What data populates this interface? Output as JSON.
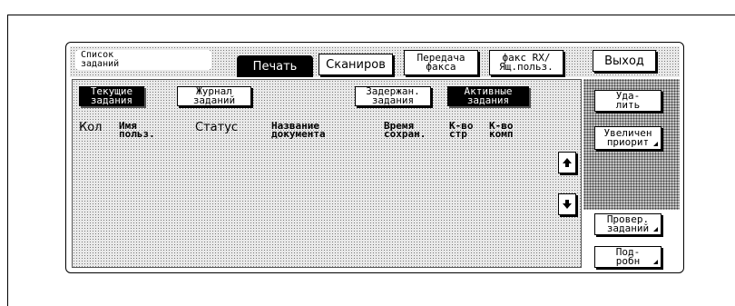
{
  "header": {
    "jobs_list_label": "Список\nзаданий",
    "tabs": [
      "Печать",
      "Сканиров",
      "Передача\nфакса",
      "факс RX/\nЯщ.польз."
    ],
    "exit_label": "Выход"
  },
  "filters": {
    "current_jobs": "Текущие\nзадания",
    "job_log": "Журнал\nзаданий",
    "held_jobs": "Задержан.\nзадания",
    "active_jobs": "Активные\nзадания"
  },
  "table": {
    "columns": [
      "Кол",
      "Имя\nпольз.",
      "Статус",
      "Название\nдокумента",
      "Время\nсохран.",
      "К-во\nстр",
      "К-во\nкомп"
    ]
  },
  "side_actions": {
    "delete": "Уда-\nлить",
    "increase_priority": "Увеличен\nприорит",
    "check_jobs": "Провер.\nзаданий",
    "details": "Под-\nробн"
  },
  "icons": {
    "scroll_up": "arrow-up-icon",
    "scroll_down": "arrow-down-icon"
  }
}
